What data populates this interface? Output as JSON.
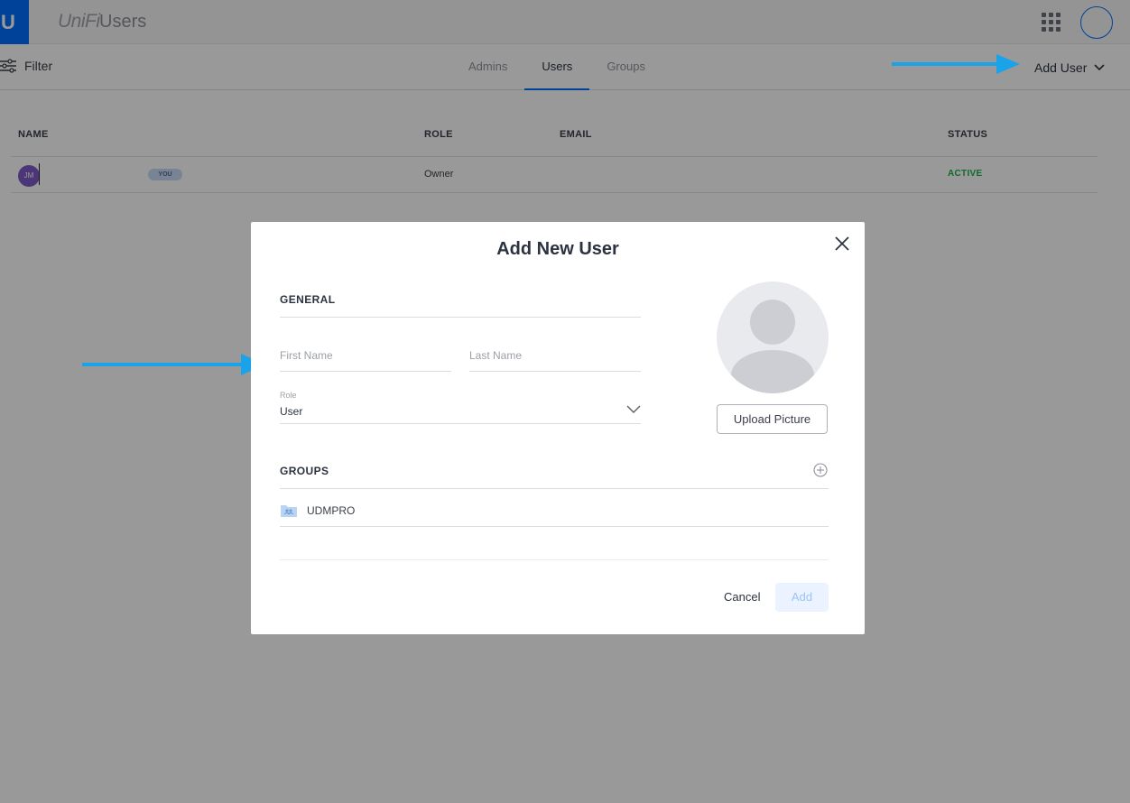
{
  "topbar": {
    "logo_letter": "U",
    "brand": "UniFi",
    "app_name": "Users"
  },
  "subbar": {
    "filter_label": "Filter",
    "tabs": [
      {
        "label": "Admins"
      },
      {
        "label": "Users"
      },
      {
        "label": "Groups"
      }
    ],
    "active_tab": "Users",
    "add_user_label": "Add User"
  },
  "table": {
    "headers": {
      "name": "NAME",
      "role": "ROLE",
      "email": "EMAIL",
      "status": "STATUS"
    },
    "rows": [
      {
        "initials": "JM",
        "badge": "YOU",
        "role": "Owner",
        "email": "",
        "status": "ACTIVE"
      }
    ]
  },
  "modal": {
    "title": "Add New User",
    "general_title": "GENERAL",
    "first_name_placeholder": "First Name",
    "last_name_placeholder": "Last Name",
    "role_label": "Role",
    "role_value": "User",
    "upload_label": "Upload Picture",
    "groups_title": "GROUPS",
    "groups": [
      {
        "name": "UDMPRO"
      }
    ],
    "cancel_label": "Cancel",
    "add_label": "Add"
  },
  "colors": {
    "accent": "#006fff",
    "active_status": "#1bb04c",
    "annotation_arrow": "#1aa3e8"
  },
  "icons": [
    "ubiquiti-logo-icon",
    "apps-grid-icon",
    "filter-icon",
    "chevron-down-icon",
    "close-icon",
    "add-circle-icon",
    "group-folder-icon",
    "avatar-placeholder-icon"
  ]
}
